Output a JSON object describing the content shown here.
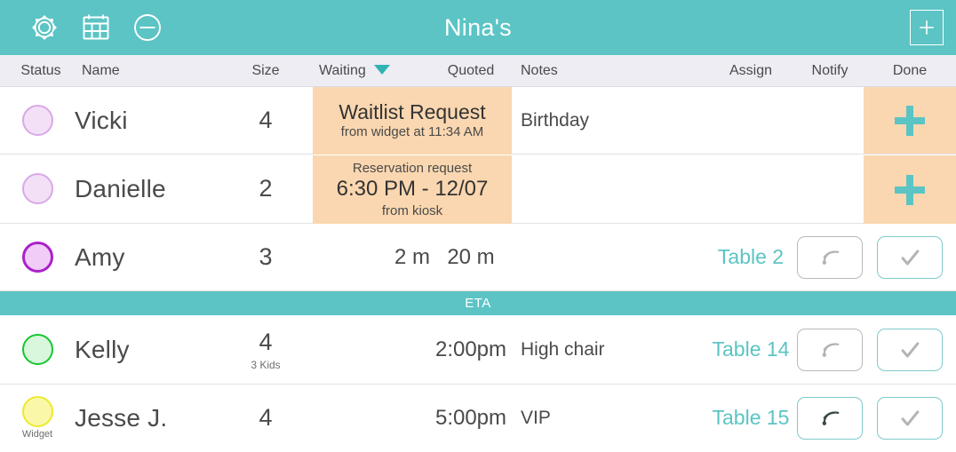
{
  "header": {
    "title": "Nina's",
    "icons": [
      {
        "name": "settings-gear-icon",
        "label": "Settings"
      },
      {
        "name": "calendar-icon",
        "label": "Calendar"
      },
      {
        "name": "minus-circle-icon",
        "label": "Remove"
      }
    ],
    "add_label": "+"
  },
  "columns": [
    {
      "key": "status",
      "label": "Status"
    },
    {
      "key": "name",
      "label": "Name"
    },
    {
      "key": "size",
      "label": "Size"
    },
    {
      "key": "waiting",
      "label": "Waiting",
      "sorted": true,
      "sort_dir": "desc"
    },
    {
      "key": "quoted",
      "label": "Quoted"
    },
    {
      "key": "notes",
      "label": "Notes"
    },
    {
      "key": "assign",
      "label": "Assign"
    },
    {
      "key": "notify",
      "label": "Notify"
    },
    {
      "key": "done",
      "label": "Done"
    }
  ],
  "requests": [
    {
      "name": "Vicki",
      "size": "4",
      "status_color": "#f3e0f7",
      "status_border": "#d9a8e8",
      "request_title": "Waitlist Request",
      "request_sub": "from widget at 11:34 AM",
      "request_mid": "",
      "request_foot": "",
      "notes": "Birthday",
      "done_icon": "plus-icon"
    },
    {
      "name": "Danielle",
      "size": "2",
      "status_color": "#f3e0f7",
      "status_border": "#d9a8e8",
      "request_title": "Reservation request",
      "request_sub": "",
      "request_mid": "6:30 PM - 12/07",
      "request_foot": "from kiosk",
      "notes": "",
      "done_icon": "plus-icon"
    }
  ],
  "rows": [
    {
      "name": "Amy",
      "size": "3",
      "size_sub": "",
      "status_color": "#f0ccf7",
      "status_border": "#aa21c9",
      "status_sub": "",
      "waiting": "2 m",
      "quoted": "20 m",
      "notes": "",
      "assign": "Table 2",
      "notify_icon": "signal-broadcast-icon",
      "notify_active": false,
      "done_icon": "check-icon"
    }
  ],
  "divider": {
    "label": "ETA"
  },
  "eta_rows": [
    {
      "name": "Kelly",
      "size": "4",
      "size_sub": "3 Kids",
      "status_color": "#d8f7dc",
      "status_border": "#16c62e",
      "status_sub": "",
      "waiting": "",
      "quoted": "2:00pm",
      "notes": "High chair",
      "assign": "Table 14",
      "notify_icon": "signal-broadcast-icon",
      "notify_active": false,
      "done_icon": "check-icon"
    },
    {
      "name": "Jesse J.",
      "size": "4",
      "size_sub": "",
      "status_color": "#fbf7a8",
      "status_border": "#ece92e",
      "status_sub": "Widget",
      "waiting": "",
      "quoted": "5:00pm",
      "notes": "VIP",
      "assign": "Table 15",
      "notify_icon": "signal-broadcast-icon",
      "notify_active": true,
      "done_icon": "check-icon"
    }
  ],
  "colors": {
    "brand_teal": "#5cc4c4",
    "request_peach": "#fad7b0",
    "header_row": "#eeedf4",
    "assign_link": "#5cc4c4"
  }
}
